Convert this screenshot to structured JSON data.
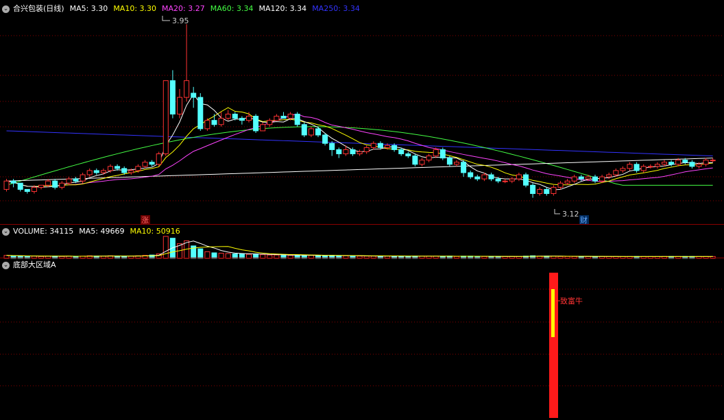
{
  "main_legend": {
    "title": "合兴包装(日线)",
    "items": [
      {
        "text": "MA5: 3.30",
        "color": "#ffffff"
      },
      {
        "text": "MA10: 3.30",
        "color": "#ffff00"
      },
      {
        "text": "MA20: 3.27",
        "color": "#ff44ff"
      },
      {
        "text": "MA60: 3.34",
        "color": "#44ff44"
      },
      {
        "text": "MA120: 3.34",
        "color": "#ffffff"
      },
      {
        "text": "MA250: 3.34",
        "color": "#3333ff"
      }
    ]
  },
  "vol_legend": {
    "items": [
      {
        "text": "VOLUME: 34115",
        "color": "#ffffff"
      },
      {
        "text": "MA5: 49669",
        "color": "#ffffff"
      },
      {
        "text": "MA10: 50916",
        "color": "#ffff00"
      }
    ]
  },
  "ind_legend": {
    "title": "底部大区域A"
  },
  "annotations": {
    "high": "3.95",
    "low": "3.12",
    "badge_zhang": "涨",
    "badge_cai": "财",
    "signal": "致富牛"
  },
  "colors": {
    "up": "#ff3333",
    "down": "#54ffff",
    "ma5": "#ffffff",
    "ma10": "#ffff00",
    "ma20": "#ff44ff",
    "ma60": "#44ff44",
    "ma120": "#ffffff",
    "ma250": "#3333ff",
    "grid": "#8b0000"
  },
  "chart_data": {
    "type": "candlestick",
    "price_range": [
      3.05,
      4.0
    ],
    "candles": [
      [
        3.16,
        3.2,
        3.21,
        3.15
      ],
      [
        3.2,
        3.19,
        3.21,
        3.17
      ],
      [
        3.19,
        3.16,
        3.19,
        3.15
      ],
      [
        3.16,
        3.15,
        3.16,
        3.14
      ],
      [
        3.15,
        3.17,
        3.18,
        3.14
      ],
      [
        3.17,
        3.18,
        3.18,
        3.16
      ],
      [
        3.18,
        3.2,
        3.21,
        3.17
      ],
      [
        3.2,
        3.17,
        3.21,
        3.16
      ],
      [
        3.17,
        3.19,
        3.2,
        3.16
      ],
      [
        3.19,
        3.21,
        3.22,
        3.18
      ],
      [
        3.21,
        3.2,
        3.22,
        3.19
      ],
      [
        3.2,
        3.23,
        3.24,
        3.19
      ],
      [
        3.23,
        3.25,
        3.26,
        3.22
      ],
      [
        3.25,
        3.24,
        3.26,
        3.23
      ],
      [
        3.24,
        3.25,
        3.26,
        3.23
      ],
      [
        3.25,
        3.27,
        3.28,
        3.24
      ],
      [
        3.27,
        3.26,
        3.28,
        3.25
      ],
      [
        3.26,
        3.24,
        3.27,
        3.23
      ],
      [
        3.24,
        3.25,
        3.26,
        3.23
      ],
      [
        3.25,
        3.27,
        3.28,
        3.24
      ],
      [
        3.27,
        3.29,
        3.3,
        3.26
      ],
      [
        3.29,
        3.28,
        3.3,
        3.27
      ],
      [
        3.28,
        3.33,
        3.34,
        3.27
      ],
      [
        3.33,
        3.68,
        3.68,
        3.32
      ],
      [
        3.68,
        3.52,
        3.73,
        3.5
      ],
      [
        3.52,
        3.6,
        3.64,
        3.5
      ],
      [
        3.6,
        3.68,
        3.95,
        3.58
      ],
      [
        3.62,
        3.6,
        3.65,
        3.55
      ],
      [
        3.6,
        3.45,
        3.62,
        3.44
      ],
      [
        3.45,
        3.49,
        3.5,
        3.44
      ],
      [
        3.49,
        3.47,
        3.52,
        3.46
      ],
      [
        3.47,
        3.5,
        3.53,
        3.46
      ],
      [
        3.5,
        3.52,
        3.54,
        3.49
      ],
      [
        3.52,
        3.5,
        3.53,
        3.49
      ],
      [
        3.5,
        3.49,
        3.51,
        3.47
      ],
      [
        3.49,
        3.51,
        3.53,
        3.48
      ],
      [
        3.51,
        3.44,
        3.52,
        3.43
      ],
      [
        3.44,
        3.47,
        3.48,
        3.44
      ],
      [
        3.47,
        3.49,
        3.5,
        3.46
      ],
      [
        3.49,
        3.51,
        3.52,
        3.49
      ],
      [
        3.51,
        3.5,
        3.53,
        3.5
      ],
      [
        3.5,
        3.52,
        3.53,
        3.49
      ],
      [
        3.52,
        3.47,
        3.53,
        3.46
      ],
      [
        3.47,
        3.42,
        3.48,
        3.41
      ],
      [
        3.42,
        3.45,
        3.46,
        3.41
      ],
      [
        3.45,
        3.42,
        3.46,
        3.41
      ],
      [
        3.42,
        3.38,
        3.43,
        3.37
      ],
      [
        3.38,
        3.35,
        3.39,
        3.32
      ],
      [
        3.35,
        3.33,
        3.36,
        3.31
      ],
      [
        3.33,
        3.35,
        3.37,
        3.32
      ],
      [
        3.35,
        3.33,
        3.36,
        3.32
      ],
      [
        3.33,
        3.34,
        3.35,
        3.32
      ],
      [
        3.34,
        3.36,
        3.37,
        3.33
      ],
      [
        3.36,
        3.38,
        3.39,
        3.35
      ],
      [
        3.38,
        3.36,
        3.39,
        3.35
      ],
      [
        3.36,
        3.37,
        3.38,
        3.35
      ],
      [
        3.37,
        3.35,
        3.38,
        3.34
      ],
      [
        3.35,
        3.33,
        3.36,
        3.32
      ],
      [
        3.33,
        3.32,
        3.34,
        3.31
      ],
      [
        3.32,
        3.28,
        3.33,
        3.27
      ],
      [
        3.28,
        3.3,
        3.31,
        3.27
      ],
      [
        3.3,
        3.32,
        3.33,
        3.29
      ],
      [
        3.32,
        3.35,
        3.36,
        3.31
      ],
      [
        3.35,
        3.31,
        3.36,
        3.3
      ],
      [
        3.31,
        3.28,
        3.32,
        3.27
      ],
      [
        3.28,
        3.29,
        3.3,
        3.27
      ],
      [
        3.29,
        3.24,
        3.3,
        3.22
      ],
      [
        3.24,
        3.22,
        3.25,
        3.21
      ],
      [
        3.22,
        3.21,
        3.23,
        3.2
      ],
      [
        3.21,
        3.23,
        3.24,
        3.2
      ],
      [
        3.23,
        3.21,
        3.24,
        3.2
      ],
      [
        3.21,
        3.2,
        3.22,
        3.19
      ],
      [
        3.2,
        3.2,
        3.21,
        3.19
      ],
      [
        3.2,
        3.21,
        3.22,
        3.19
      ],
      [
        3.21,
        3.23,
        3.24,
        3.2
      ],
      [
        3.23,
        3.18,
        3.24,
        3.17
      ],
      [
        3.18,
        3.14,
        3.19,
        3.12
      ],
      [
        3.14,
        3.16,
        3.17,
        3.13
      ],
      [
        3.16,
        3.14,
        3.17,
        3.13
      ],
      [
        3.14,
        3.17,
        3.18,
        3.13
      ],
      [
        3.17,
        3.19,
        3.2,
        3.16
      ],
      [
        3.19,
        3.2,
        3.21,
        3.18
      ],
      [
        3.2,
        3.22,
        3.23,
        3.19
      ],
      [
        3.22,
        3.21,
        3.23,
        3.2
      ],
      [
        3.21,
        3.22,
        3.23,
        3.2
      ],
      [
        3.22,
        3.2,
        3.23,
        3.19
      ],
      [
        3.2,
        3.22,
        3.23,
        3.19
      ],
      [
        3.22,
        3.23,
        3.24,
        3.21
      ],
      [
        3.23,
        3.25,
        3.26,
        3.22
      ],
      [
        3.25,
        3.26,
        3.27,
        3.24
      ],
      [
        3.26,
        3.28,
        3.29,
        3.25
      ],
      [
        3.28,
        3.25,
        3.29,
        3.24
      ],
      [
        3.25,
        3.27,
        3.28,
        3.24
      ],
      [
        3.27,
        3.27,
        3.28,
        3.26
      ],
      [
        3.27,
        3.28,
        3.29,
        3.26
      ],
      [
        3.28,
        3.29,
        3.3,
        3.27
      ],
      [
        3.29,
        3.28,
        3.3,
        3.27
      ],
      [
        3.28,
        3.3,
        3.31,
        3.27
      ],
      [
        3.3,
        3.29,
        3.31,
        3.28
      ],
      [
        3.29,
        3.27,
        3.3,
        3.26
      ],
      [
        3.27,
        3.28,
        3.29,
        3.26
      ],
      [
        3.28,
        3.3,
        3.31,
        3.27
      ],
      [
        3.3,
        3.3,
        3.31,
        3.29
      ]
    ],
    "volume": [
      8,
      7,
      6,
      5,
      6,
      5,
      6,
      6,
      5,
      6,
      5,
      6,
      7,
      6,
      6,
      7,
      6,
      6,
      6,
      7,
      8,
      9,
      12,
      60,
      55,
      40,
      48,
      34,
      26,
      18,
      15,
      14,
      13,
      12,
      12,
      11,
      12,
      10,
      9,
      9,
      8,
      8,
      9,
      8,
      8,
      7,
      7,
      8,
      7,
      7,
      7,
      6,
      6,
      6,
      6,
      6,
      6,
      6,
      5,
      6,
      6,
      6,
      6,
      5,
      6,
      5,
      6,
      6,
      5,
      5,
      5,
      5,
      5,
      5,
      5,
      6,
      7,
      6,
      6,
      6,
      5,
      5,
      5,
      5,
      5,
      5,
      5,
      5,
      5,
      5,
      5,
      5,
      5,
      5,
      5,
      5,
      5,
      5,
      5,
      5,
      5,
      5,
      5
    ],
    "signal_index": 76
  }
}
